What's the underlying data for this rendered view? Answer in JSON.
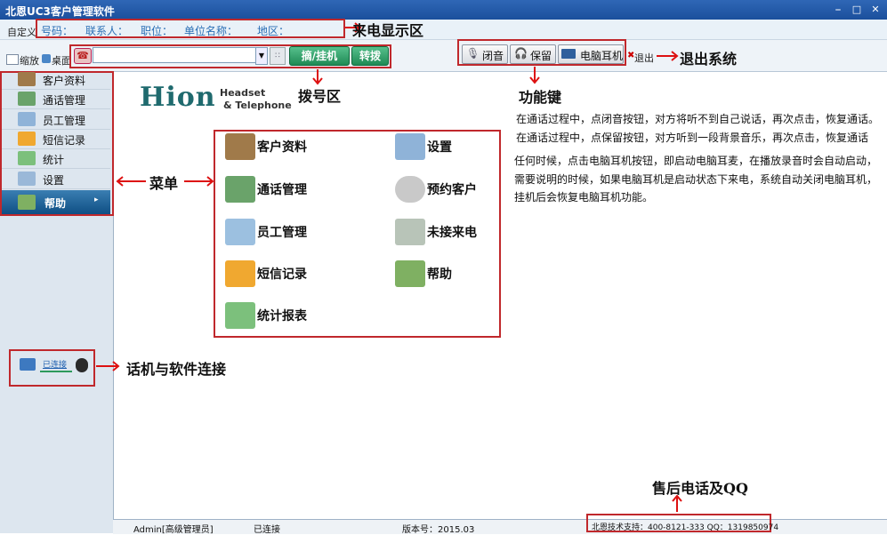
{
  "app": {
    "title": "北恩UC3客户管理软件"
  },
  "window_controls": [
    "minimize-icon",
    "maximize-icon",
    "close-icon"
  ],
  "info_bar": {
    "custom_label": "自定义",
    "fields": [
      "号码：",
      "联系人：",
      "职位：",
      "单位名称：",
      "地区："
    ]
  },
  "toolbar": {
    "zoom_label": "缩放",
    "desktop_label": "桌面",
    "dial_value": "",
    "pickup_label": "摘/挂机",
    "transfer_label": "转拨",
    "mute_label": "闭音",
    "hold_label": "保留",
    "pc_headset_label": "电脑耳机",
    "exit_label": "退出"
  },
  "sidebar": {
    "items": [
      {
        "label": "客户资料",
        "icon": "contacts-icon"
      },
      {
        "label": "通话管理",
        "icon": "call-manage-icon"
      },
      {
        "label": "员工管理",
        "icon": "staff-icon"
      },
      {
        "label": "短信记录",
        "icon": "envelope-icon"
      },
      {
        "label": "统计",
        "icon": "bar-chart-icon"
      },
      {
        "label": "设置",
        "icon": "settings-icon"
      },
      {
        "label": "帮助",
        "icon": "help-icon"
      }
    ],
    "connection_label": "已连接"
  },
  "logo": {
    "brand": "Hion",
    "tag1": "Headset",
    "tag2": "& Telephone"
  },
  "help_grid": {
    "items": [
      {
        "label": "客户资料",
        "icon": "contacts-icon"
      },
      {
        "label": "设置",
        "icon": "settings-icon"
      },
      {
        "label": "通话管理",
        "icon": "call-manage-icon"
      },
      {
        "label": "预约客户",
        "icon": "alarm-clock-icon"
      },
      {
        "label": "员工管理",
        "icon": "staff-icon"
      },
      {
        "label": "未接来电",
        "icon": "missed-call-icon"
      },
      {
        "label": "短信记录",
        "icon": "envelope-icon"
      },
      {
        "label": "帮助",
        "icon": "help-icon"
      },
      {
        "label": "统计报表",
        "icon": "bar-chart-icon"
      }
    ]
  },
  "annotations": {
    "caller_display": "来电显示区",
    "exit_system": "退出系统",
    "dial_area": "拨号区",
    "function_keys": "功能键",
    "menu": "菜单",
    "phone_connection": "话机与软件连接",
    "aftersale": "售后电话及QQ"
  },
  "descriptions": [
    "在通话过程中，点闭音按钮，对方将听不到自己说话，再次点击，恢复通话。",
    "在通话过程中，点保留按钮，对方听到一段背景音乐，再次点击，恢复通话",
    "任何时候，点击电脑耳机按钮，即启动电脑耳麦，在播放录音时会自动启动，",
    "需要说明的时候，如果电脑耳机是启动状态下来电，系统自动关闭电脑耳机，",
    "挂机后会恢复电脑耳机功能。"
  ],
  "status_bar": {
    "user": "Admin[高级管理员]",
    "connection": "已连接",
    "version": "版本号：2015.03",
    "support": "北恩技术支持：400-8121-333 QQ：1319850974"
  },
  "colors": {
    "title_bar": "#1f56a3",
    "annotation_red": "#c0282c",
    "dial_green": "#2e9e66",
    "label_blue": "#2a6fb5"
  }
}
